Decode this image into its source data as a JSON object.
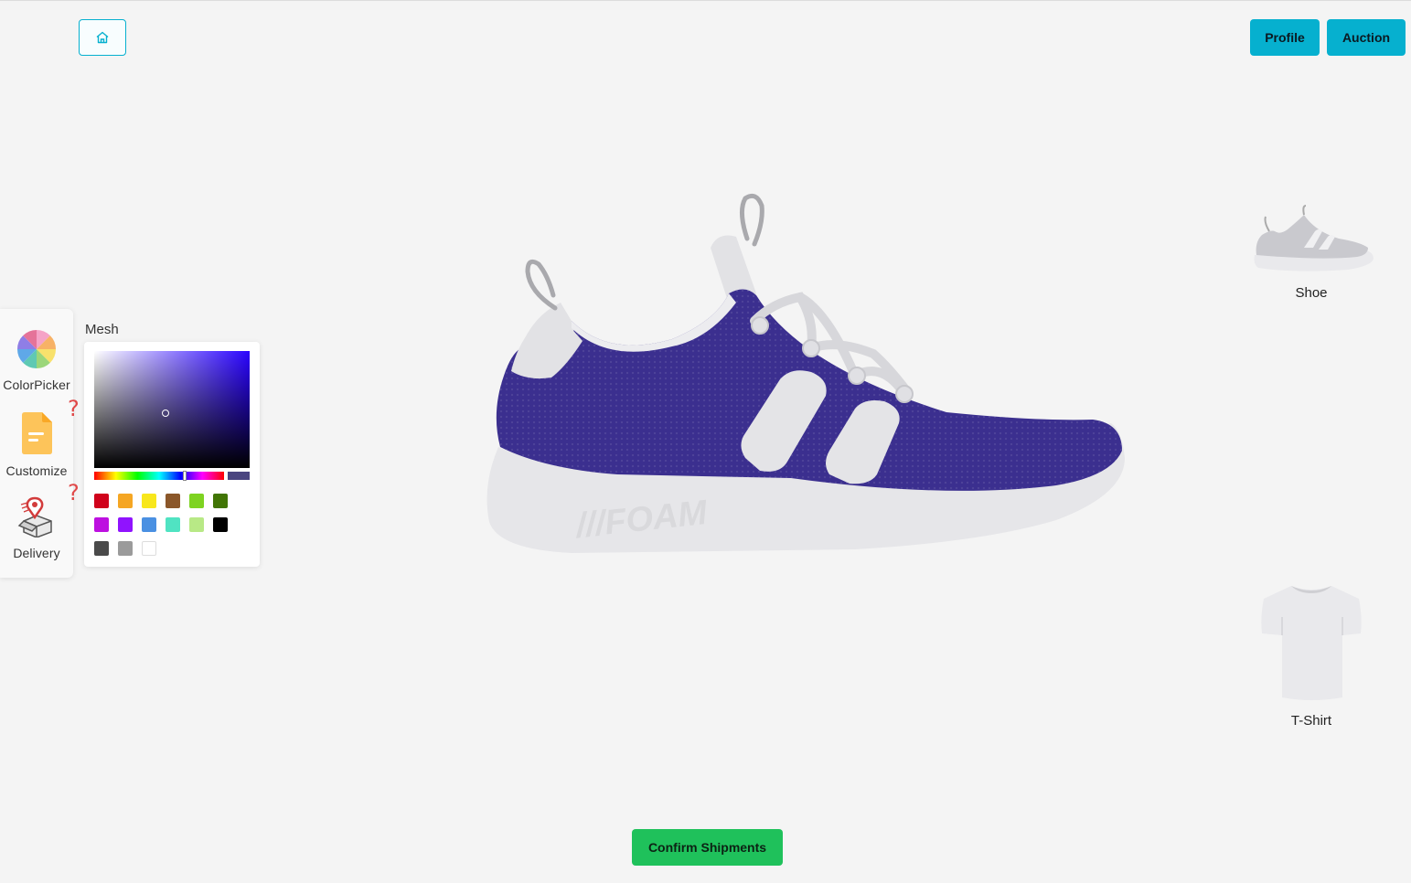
{
  "header": {
    "home_icon": "home-icon",
    "profile_label": "Profile",
    "auction_label": "Auction"
  },
  "colors": {
    "accent": "#06b0cf",
    "confirm": "#1fc15b",
    "question": "#e04848",
    "selected_color": "#4a4580"
  },
  "tools": {
    "colorpicker_label": "ColorPicker",
    "customize_label": "Customize",
    "delivery_label": "Delivery",
    "help_glyph": "?"
  },
  "picker": {
    "part_label": "Mesh",
    "hue_color": "#2a04ff",
    "swatches": [
      "#d0021b",
      "#f5a623",
      "#f8e71c",
      "#8b572a",
      "#7ed321",
      "#417505",
      "#bd10e0",
      "#9013fe",
      "#4a90e2",
      "#50e3c2",
      "#b8e986",
      "#000000",
      "#4a4a4a",
      "#9b9b9b",
      "#ffffff"
    ]
  },
  "products": {
    "shoe_label": "Shoe",
    "tshirt_label": "T-Shirt"
  },
  "viewer": {
    "shoe_color": "#3b2f8f",
    "sole_text": "///FOAM"
  },
  "footer": {
    "confirm_label": "Confirm Shipments"
  }
}
